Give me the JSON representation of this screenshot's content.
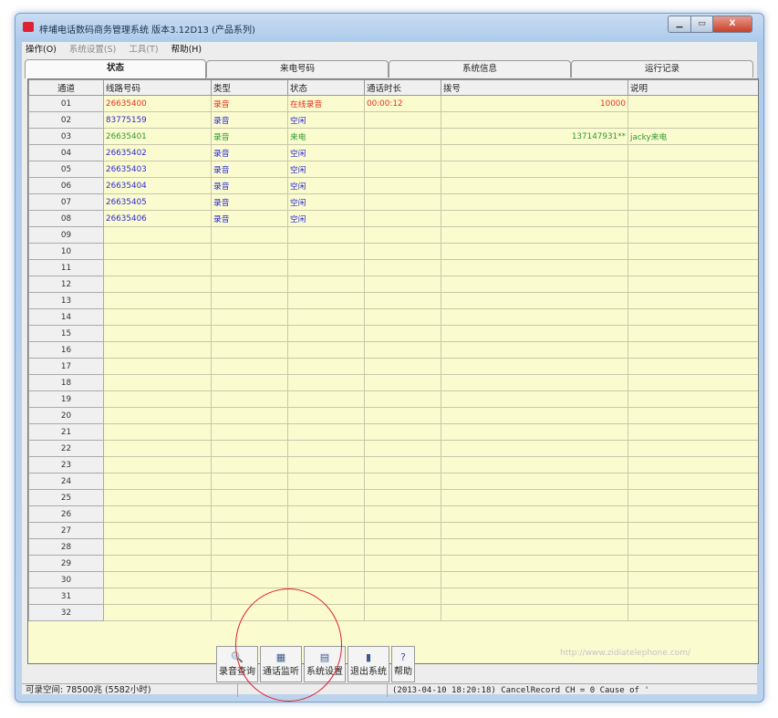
{
  "window": {
    "title": "梓埔电话数码商务管理系统 版本3.12D13 (产品系列)",
    "minimize_icon": "minimize-icon",
    "maximize_icon": "maximize-icon",
    "close_icon": "close-icon",
    "min_glyph": "▁",
    "max_glyph": "▭",
    "close_glyph": "X"
  },
  "menu": [
    "操作(O)",
    "系统设置(S)",
    "工具(T)",
    "帮助(H)"
  ],
  "tabs": [
    "状态",
    "来电号码",
    "系统信息",
    "运行记录"
  ],
  "columns": [
    "通道",
    "线路号码",
    "类型",
    "状态",
    "通话时长",
    "拨号",
    "说明"
  ],
  "rows": [
    {
      "ch": "01",
      "line": "26635400",
      "type": "录音",
      "status": "在线录音",
      "duration": "00:00:12",
      "dial": "10000",
      "note": "",
      "color": "#e8321e"
    },
    {
      "ch": "02",
      "line": "83775159",
      "type": "录音",
      "status": "空闲",
      "duration": "",
      "dial": "",
      "note": "",
      "color": "#2a2ad6"
    },
    {
      "ch": "03",
      "line": "26635401",
      "type": "录音",
      "status": "来电",
      "duration": "",
      "dial": "137147931**",
      "note": "jacky来电",
      "color": "#2e9a2e"
    },
    {
      "ch": "04",
      "line": "26635402",
      "type": "录音",
      "status": "空闲",
      "duration": "",
      "dial": "",
      "note": "",
      "color": "#2a2ad6"
    },
    {
      "ch": "05",
      "line": "26635403",
      "type": "录音",
      "status": "空闲",
      "duration": "",
      "dial": "",
      "note": "",
      "color": "#2a2ad6"
    },
    {
      "ch": "06",
      "line": "26635404",
      "type": "录音",
      "status": "空闲",
      "duration": "",
      "dial": "",
      "note": "",
      "color": "#2a2ad6"
    },
    {
      "ch": "07",
      "line": "26635405",
      "type": "录音",
      "status": "空闲",
      "duration": "",
      "dial": "",
      "note": "",
      "color": "#2a2ad6"
    },
    {
      "ch": "08",
      "line": "26635406",
      "type": "录音",
      "status": "空闲",
      "duration": "",
      "dial": "",
      "note": "",
      "color": "#2a2ad6"
    },
    {
      "ch": "09"
    },
    {
      "ch": "10"
    },
    {
      "ch": "11"
    },
    {
      "ch": "12"
    },
    {
      "ch": "13"
    },
    {
      "ch": "14"
    },
    {
      "ch": "15"
    },
    {
      "ch": "16"
    },
    {
      "ch": "17"
    },
    {
      "ch": "18"
    },
    {
      "ch": "19"
    },
    {
      "ch": "20"
    },
    {
      "ch": "21"
    },
    {
      "ch": "22"
    },
    {
      "ch": "23"
    },
    {
      "ch": "24"
    },
    {
      "ch": "25"
    },
    {
      "ch": "26"
    },
    {
      "ch": "27"
    },
    {
      "ch": "28"
    },
    {
      "ch": "29"
    },
    {
      "ch": "30"
    },
    {
      "ch": "31"
    },
    {
      "ch": "32"
    }
  ],
  "watermark": "http://www.zidiatelephone.com/",
  "toolbar": [
    {
      "label": "录音查询",
      "icon": "search-icon",
      "glyph": "🔍"
    },
    {
      "label": "通话监听",
      "icon": "monitor-icon",
      "glyph": "▦"
    },
    {
      "label": "系统设置",
      "icon": "settings-icon",
      "glyph": "▤"
    },
    {
      "label": "退出系统",
      "icon": "exit-icon",
      "glyph": "▮"
    },
    {
      "label": "帮助",
      "icon": "help-icon",
      "glyph": "?"
    }
  ],
  "status": {
    "left": "可录空间: 78500兆 (5582小时)",
    "right": "(2013-04-10 18:20:18) CancelRecord CH = 0 Cause of '"
  },
  "colors": {
    "title_bar": "#aecbec",
    "grid_bg": "#fbfbd0",
    "annotation_circle": "#e0202a"
  }
}
